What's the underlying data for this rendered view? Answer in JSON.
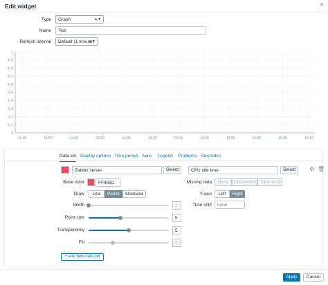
{
  "dialog": {
    "title": "Edit widget",
    "close_glyph": "×"
  },
  "form": {
    "type_label": "Type",
    "type_value": "Graph",
    "name_label": "Name",
    "name_value": "Test",
    "refresh_label": "Refresh interval",
    "refresh_value": "Default (1 minute)"
  },
  "chart_data": {
    "type": "line",
    "x": [
      "11:45",
      "11:50",
      "11:55",
      "12:00",
      "12:05",
      "12:10",
      "12:15",
      "12:20",
      "12:25",
      "12:30",
      "12:35",
      "12:40"
    ],
    "y_ticks": [
      0,
      0.1,
      0.2,
      0.3,
      0.4,
      0.5,
      0.6,
      0.7,
      0.8,
      0.9,
      1
    ],
    "ylim": [
      0,
      1
    ],
    "series": [],
    "grid": true
  },
  "tabs": [
    "Data set",
    "Display options",
    "Time period",
    "Axes",
    "Legend",
    "Problems",
    "Overrides"
  ],
  "dataset": {
    "color_hex": "#FF465C",
    "host_value": "Zabbix server",
    "host_select": "Select",
    "item_value": "CPU idle time",
    "item_select": "Select",
    "base_color_label": "Base color",
    "base_color_value": "FF465C",
    "draw_label": "Draw",
    "draw_options": [
      "Line",
      "Points",
      "Staircase"
    ],
    "draw_selected": "Points",
    "width_label": "Width",
    "width_value": "1",
    "width_level": 0,
    "point_size_label": "Point size",
    "point_size_value": "5",
    "point_size_level": 0.4,
    "transparency_label": "Transparency",
    "transparency_value": "5",
    "transparency_level": 0.5,
    "fill_label": "Fill",
    "fill_value": "3",
    "fill_level": 0.3,
    "missing_data_label": "Missing data",
    "missing_options": [
      "None",
      "Connected",
      "Treat as 0"
    ],
    "yaxis_label": "Y-axis",
    "yaxis_options": [
      "Left",
      "Right"
    ],
    "yaxis_selected": "Right",
    "time_shift_label": "Time shift",
    "time_shift_placeholder": "none",
    "add_button": "+ Add new data set"
  },
  "footer": {
    "apply": "Apply",
    "cancel": "Cancel"
  },
  "colors": {
    "accent": "#0275b8",
    "toggle_on": "#768d99"
  }
}
